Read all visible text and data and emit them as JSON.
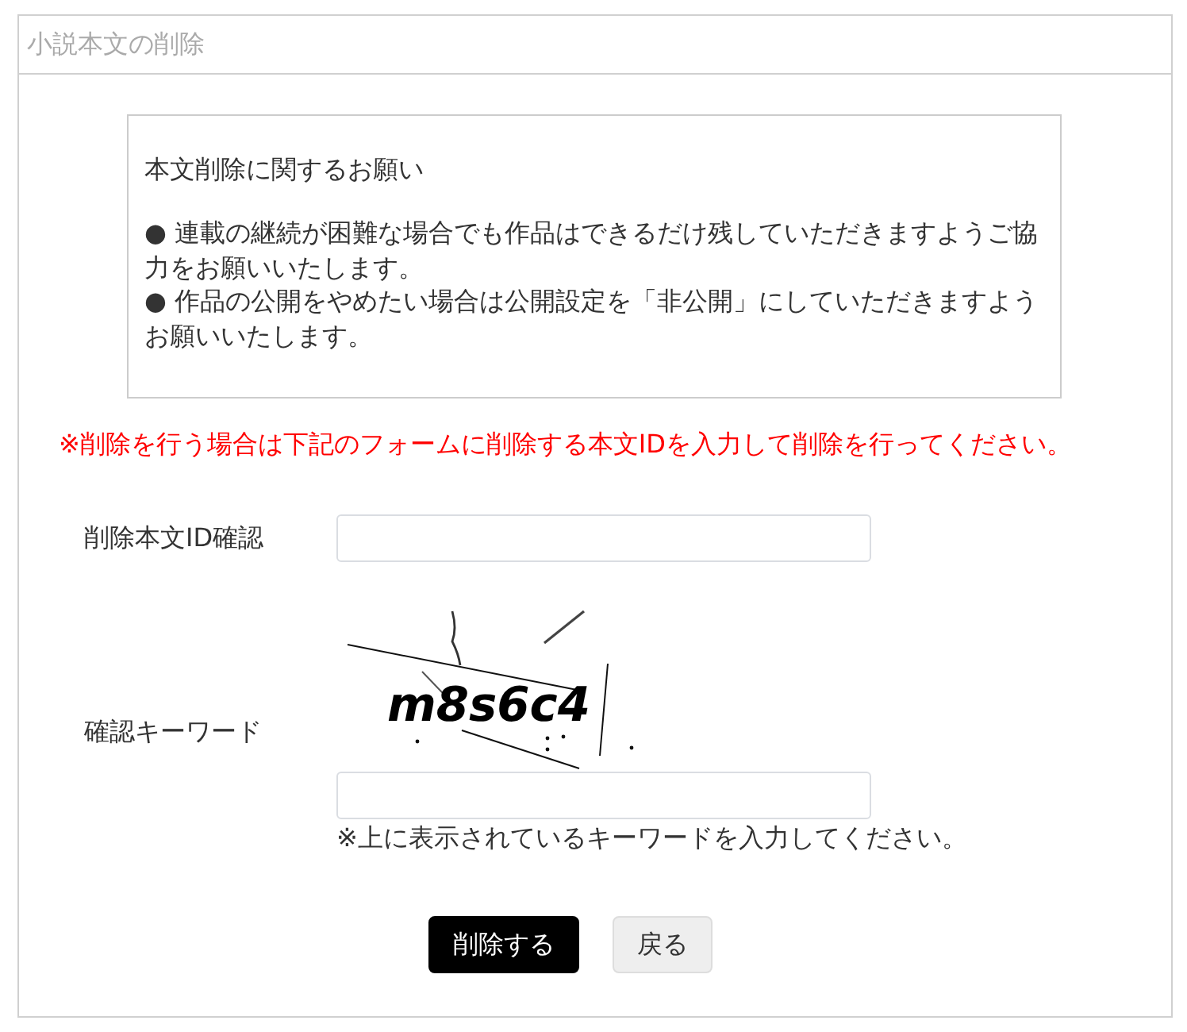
{
  "panel": {
    "title": "小説本文の削除"
  },
  "notice": {
    "heading": "本文削除に関するお願い",
    "items": [
      "● 連載の継続が困難な場合でも作品はできるだけ残していただきますようご協力をお願いいたします。",
      "● 作品の公開をやめたい場合は公開設定を「非公開」にしていただきますようお願いいたします。"
    ]
  },
  "warning": "※削除を行う場合は下記のフォームに削除する本文IDを入力して削除を行ってください。",
  "form": {
    "fields": [
      {
        "kind": "text",
        "label": "削除本文ID確認"
      },
      {
        "kind": "captcha",
        "label": "確認キーワード",
        "captcha": "m8s6c4",
        "hint": "※上に表示されているキーワードを入力してください。"
      }
    ]
  },
  "buttons": [
    {
      "kind": "primary",
      "label": "削除する"
    },
    {
      "kind": "secondary",
      "label": "戻る"
    }
  ]
}
